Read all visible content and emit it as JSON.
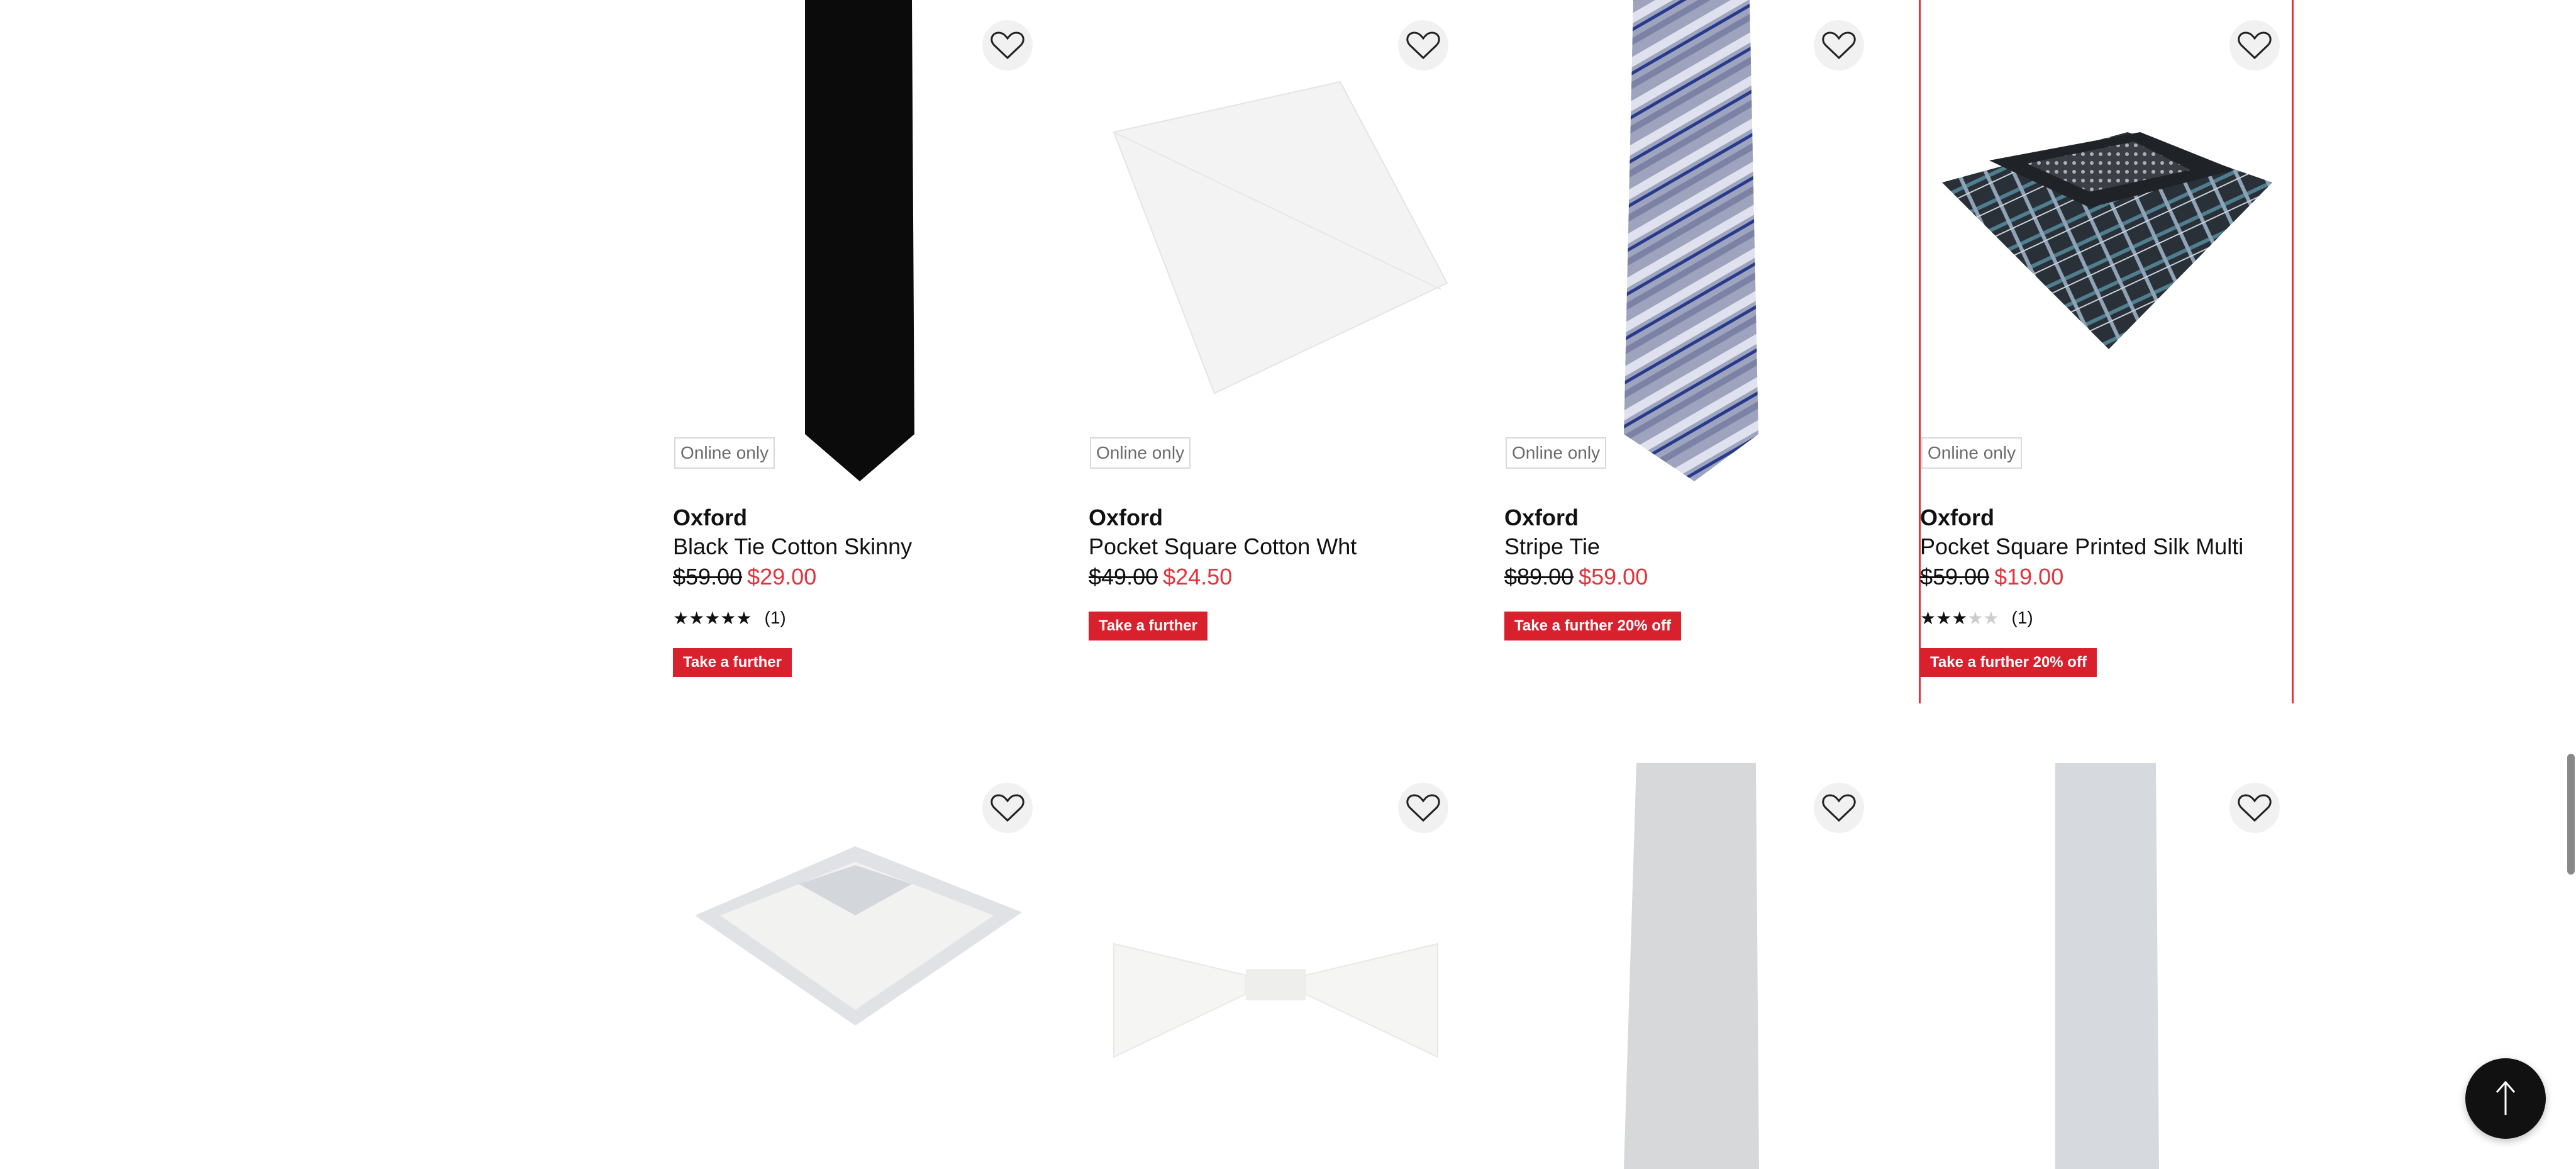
{
  "products_row1": [
    {
      "badge": "Online only",
      "brand": "Oxford",
      "title": "Black Tie Cotton Skinny",
      "was": "$59.00",
      "now": "$29.00",
      "rating_count": "(1)",
      "stars": 5,
      "promo": "Take a further"
    },
    {
      "badge": "Online only",
      "brand": "Oxford",
      "title": "Pocket Square Cotton Wht",
      "was": "$49.00",
      "now": "$24.50",
      "promo": "Take a further"
    },
    {
      "badge": "Online only",
      "brand": "Oxford",
      "title": "Stripe Tie",
      "was": "$89.00",
      "now": "$59.00",
      "promo": "Take a further 20% off"
    },
    {
      "badge": "Online only",
      "brand": "Oxford",
      "title": "Pocket Square Printed Silk Multi",
      "was": "$59.00",
      "now": "$19.00",
      "rating_count": "(1)",
      "stars": 3,
      "promo": "Take a further 20% off"
    }
  ],
  "icons": {
    "favorite": "heart-outline-icon",
    "back_to_top": "arrow-up-icon"
  },
  "colors": {
    "sale": "#e3323b",
    "promo_bg": "#d9202d",
    "focus_border": "#e3323b"
  }
}
